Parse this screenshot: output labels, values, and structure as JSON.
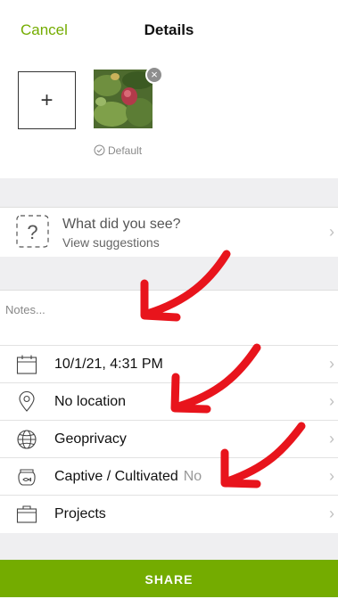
{
  "header": {
    "cancel_label": "Cancel",
    "title": "Details"
  },
  "photos": {
    "add_label": "+",
    "remove_label": "×",
    "default_label": "Default"
  },
  "species": {
    "question": "What did you see?",
    "suggestions": "View suggestions",
    "icon_glyph": "?"
  },
  "notes": {
    "placeholder": "Notes..."
  },
  "rows": [
    {
      "label": "10/1/21, 4:31 PM",
      "value": "",
      "icon": "calendar-icon"
    },
    {
      "label": "No location",
      "value": "",
      "icon": "location-pin-icon"
    },
    {
      "label": "Geoprivacy",
      "value": "",
      "icon": "globe-icon"
    },
    {
      "label": "Captive / Cultivated",
      "value": "No",
      "icon": "captive-icon"
    },
    {
      "label": "Projects",
      "value": "",
      "icon": "projects-briefcase-icon"
    }
  ],
  "footer": {
    "share_label": "SHARE"
  },
  "colors": {
    "accent": "#74ac00",
    "annotation": "#e8141c"
  },
  "chevron_glyph": "›"
}
